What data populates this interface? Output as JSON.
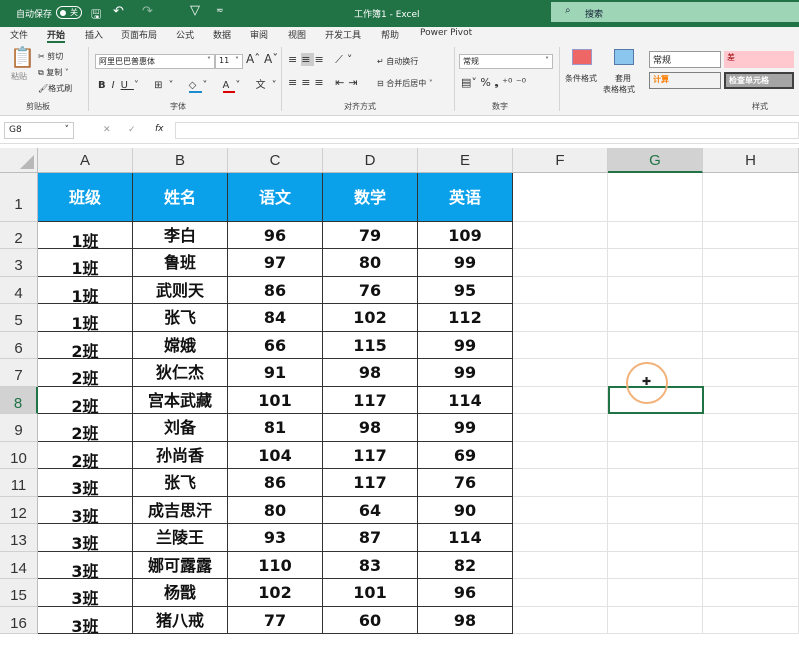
{
  "titlebar": {
    "autosave": "自动保存",
    "toggle": "关",
    "title": "工作簿1 - Excel",
    "search": "搜索"
  },
  "tabs": [
    "文件",
    "开始",
    "插入",
    "页面布局",
    "公式",
    "数据",
    "审阅",
    "视图",
    "开发工具",
    "帮助",
    "Power Pivot"
  ],
  "ribbon": {
    "paste": "粘贴",
    "cut": "剪切",
    "copy": "复制",
    "format_painter": "格式刷",
    "clipboard": "剪贴板",
    "font_name": "阿里巴巴普惠体",
    "font_size": "11",
    "font_group": "字体",
    "wrap": "自动换行",
    "merge": "合并后居中",
    "align_group": "对齐方式",
    "number_format": "常规",
    "number_group": "数字",
    "cond_format": "条件格式",
    "table_format_1": "套用",
    "table_format_2": "表格格式",
    "style_normal": "常规",
    "style_bad": "差",
    "style_calc": "计算",
    "style_check": "检查单元格",
    "styles_group": "样式"
  },
  "formula": {
    "namebox": "G8",
    "fx": "fx",
    "value": ""
  },
  "columns": [
    "A",
    "B",
    "C",
    "D",
    "E",
    "F",
    "G",
    "H"
  ],
  "selected_cell": "G8",
  "table": {
    "headers": [
      "班级",
      "姓名",
      "语文",
      "数学",
      "英语"
    ],
    "rows": [
      [
        "1班",
        "李白",
        "96",
        "79",
        "109"
      ],
      [
        "1班",
        "鲁班",
        "97",
        "80",
        "99"
      ],
      [
        "1班",
        "武则天",
        "86",
        "76",
        "95"
      ],
      [
        "1班",
        "张飞",
        "84",
        "102",
        "112"
      ],
      [
        "2班",
        "嫦娥",
        "66",
        "115",
        "99"
      ],
      [
        "2班",
        "狄仁杰",
        "91",
        "98",
        "99"
      ],
      [
        "2班",
        "宫本武藏",
        "101",
        "117",
        "114"
      ],
      [
        "2班",
        "刘备",
        "81",
        "98",
        "99"
      ],
      [
        "2班",
        "孙尚香",
        "104",
        "117",
        "69"
      ],
      [
        "3班",
        "张飞",
        "86",
        "117",
        "76"
      ],
      [
        "3班",
        "成吉思汗",
        "80",
        "64",
        "90"
      ],
      [
        "3班",
        "兰陵王",
        "93",
        "87",
        "114"
      ],
      [
        "3班",
        "娜可露露",
        "110",
        "83",
        "82"
      ],
      [
        "3班",
        "杨戬",
        "102",
        "101",
        "96"
      ],
      [
        "3班",
        "猪八戒",
        "77",
        "60",
        "98"
      ]
    ]
  }
}
